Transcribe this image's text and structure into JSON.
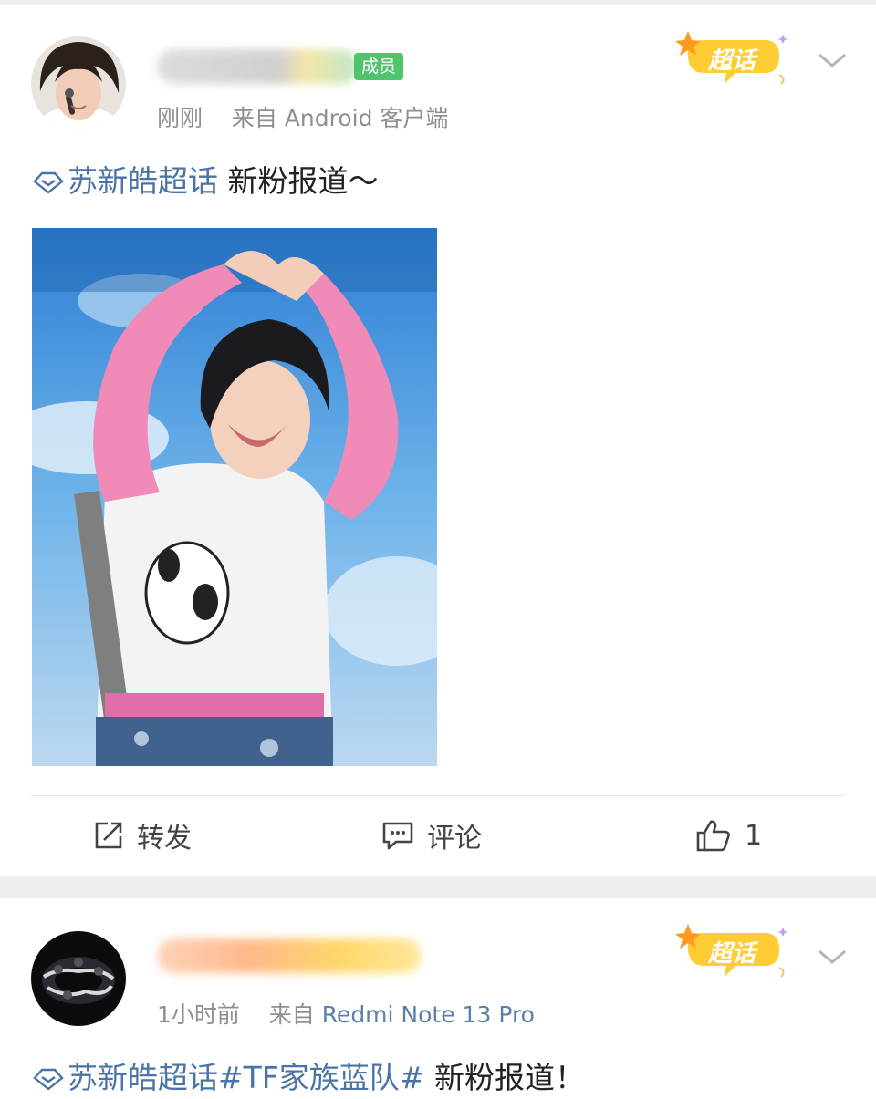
{
  "posts": [
    {
      "user_badge": "成员",
      "time": "刚刚",
      "source_prefix": "来自",
      "source": "Android 客户端",
      "topic": "苏新皓超话",
      "text": " 新粉报道～",
      "super_topic_badge": "超话",
      "actions": {
        "repost_label": "转发",
        "comment_label": "评论",
        "like_count": "1"
      }
    },
    {
      "time": "1小时前",
      "source_prefix": "来自",
      "source": "Redmi Note 13 Pro",
      "topic": "苏新皓超话#TF家族蓝队#",
      "text": " 新粉报道！",
      "super_topic_badge": "超话"
    }
  ],
  "colors": {
    "topic_link": "#4a73a6",
    "badge_green": "#4fc46b",
    "super_topic_yellow": "#ffcc33",
    "page_gap": "#eeeeee"
  },
  "icons": [
    "diamond-topic-icon",
    "chevron-down-icon",
    "repost-icon",
    "comment-icon",
    "thumbs-up-icon",
    "star-icon"
  ]
}
